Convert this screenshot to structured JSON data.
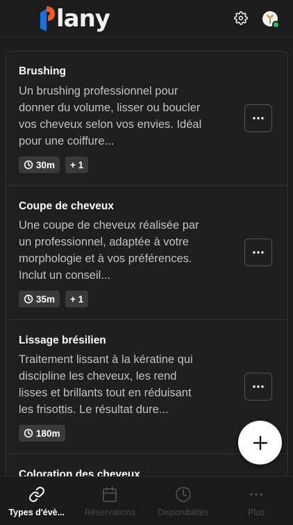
{
  "app": {
    "logo_text": "lany",
    "brand_colors": {
      "blue": "#1d6fe0",
      "orange": "#f25a1c"
    }
  },
  "header": {
    "settings_icon": "gear-icon",
    "avatar_status": "online"
  },
  "events": [
    {
      "title": "Brushing",
      "description": "Un brushing professionnel pour donner du volume, lisser ou boucler vos cheveux selon vos envies. Idéal pour une coiffure...",
      "duration": "30m",
      "extra": "+ 1"
    },
    {
      "title": "Coupe de cheveux",
      "description": "Une coupe de cheveux réalisée par un professionnel, adaptée à votre morphologie et à vos préférences. Inclut un conseil...",
      "duration": "35m",
      "extra": "+ 1"
    },
    {
      "title": "Lissage brésilien",
      "description": "Traitement lissant à la kératine qui discipline les cheveux, les rend lisses et brillants tout en réduisant les frisottis. Le résultat dure...",
      "duration": "180m"
    },
    {
      "title": "Coloration des cheveux"
    }
  ],
  "nav": {
    "items": [
      {
        "label": "Types d'évè...",
        "icon": "link-icon",
        "active": true
      },
      {
        "label": "Réservations",
        "icon": "calendar-icon",
        "active": false
      },
      {
        "label": "Disponibilités",
        "icon": "clock-icon",
        "active": false
      },
      {
        "label": "Plus",
        "icon": "more-icon",
        "active": false
      }
    ]
  }
}
